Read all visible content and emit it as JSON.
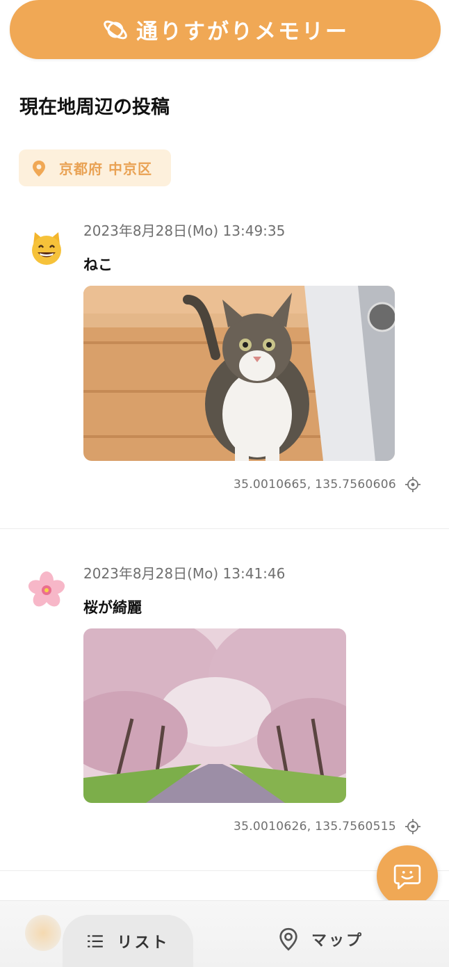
{
  "header": {
    "title": "通りすがりメモリー",
    "icon": "planet-icon"
  },
  "section": {
    "title": "現在地周辺の投稿"
  },
  "location": {
    "label": "京都府 中京区",
    "icon": "location-pin-icon"
  },
  "posts": [
    {
      "avatar": "😺",
      "timestamp": "2023年8月28日(Mo) 13:49:35",
      "text": "ねこ",
      "photo": "tabby-cat-on-wooden-floor",
      "coords": "35.0010665, 135.7560606"
    },
    {
      "avatar": "🌸",
      "timestamp": "2023年8月28日(Mo) 13:41:46",
      "text": "桜が綺麗",
      "photo": "cherry-blossom-tunnel",
      "coords": "35.0010626, 135.7560515"
    }
  ],
  "fab": {
    "icon": "chat-smile-icon"
  },
  "nav": {
    "list_label": "リスト",
    "map_label": "マップ"
  },
  "colors": {
    "accent": "#f0a855",
    "chip_bg": "#fdf0dc",
    "chip_text": "#e9a254"
  }
}
